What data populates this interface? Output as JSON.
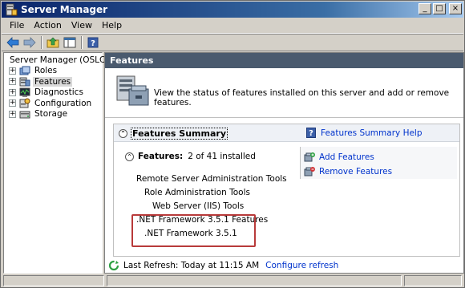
{
  "window": {
    "title": "Server Manager",
    "accent": "#0a246a",
    "controls": {
      "minimize": "_",
      "maximize": "□",
      "close": "×"
    }
  },
  "menu": {
    "items": [
      "File",
      "Action",
      "View",
      "Help"
    ]
  },
  "toolbar": {
    "buttons": [
      "back-arrow-icon",
      "forward-arrow-icon",
      "up-folder-icon",
      "show-hide-tree-icon",
      "help-icon"
    ]
  },
  "tree": {
    "items": [
      {
        "label": "Server Manager (OSLC)",
        "icon": "server-icon",
        "expander": ""
      },
      {
        "label": "Roles",
        "icon": "roles-icon",
        "expander": "+"
      },
      {
        "label": "Features",
        "icon": "features-icon",
        "expander": "+",
        "selected": true
      },
      {
        "label": "Diagnostics",
        "icon": "diagnostics-icon",
        "expander": "+"
      },
      {
        "label": "Configuration",
        "icon": "configuration-icon",
        "expander": "+"
      },
      {
        "label": "Storage",
        "icon": "storage-icon",
        "expander": "+"
      }
    ]
  },
  "pane": {
    "header": "Features",
    "description": "View the status of features installed on this server and add or remove features."
  },
  "summary": {
    "title": "Features Summary",
    "help_link": "Features Summary Help",
    "features_label": "Features:",
    "features_count": "2 of 41 installed",
    "actions": {
      "add": "Add Features",
      "remove": "Remove Features"
    },
    "installed_tree": [
      "Remote Server Administration Tools",
      "Role Administration Tools",
      "Web Server (IIS) Tools",
      ".NET Framework 3.5.1 Features",
      ".NET Framework 3.5.1"
    ]
  },
  "refresh": {
    "text": "Last Refresh: Today at 11:15 AM",
    "link": "Configure refresh"
  }
}
